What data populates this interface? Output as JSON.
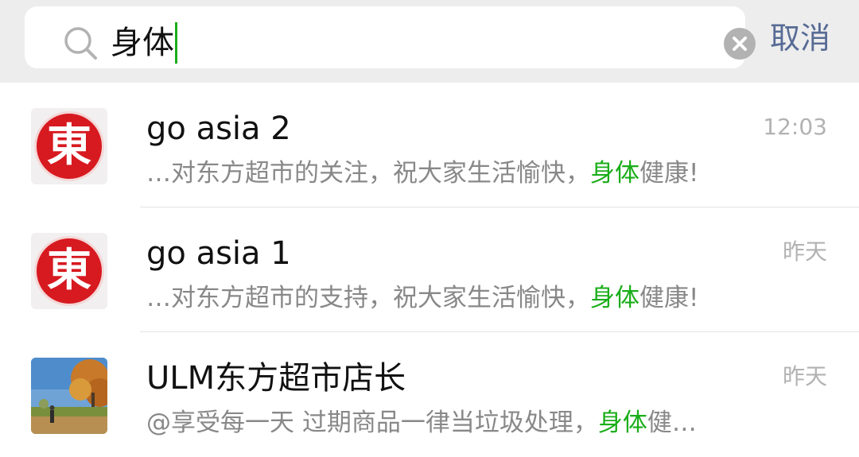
{
  "search": {
    "query": "身体",
    "cancel_label": "取消"
  },
  "results": [
    {
      "name": "go asia 2",
      "time": "12:03",
      "avatar": "dong-logo",
      "avatar_text": "東",
      "snippet_before": "…对东方超市的关注，祝大家生活愉快，",
      "snippet_highlight": "身体",
      "snippet_after": "健康!"
    },
    {
      "name": "go asia 1",
      "time": "昨天",
      "avatar": "dong-logo",
      "avatar_text": "東",
      "snippet_before": "…对东方超市的支持，祝大家生活愉快，",
      "snippet_highlight": "身体",
      "snippet_after": "健康!"
    },
    {
      "name": "ULM东方超市店长",
      "time": "昨天",
      "avatar": "autumn-photo",
      "snippet_before": "@享受每一天 过期商品一律当垃圾处理，",
      "snippet_highlight": "身体",
      "snippet_after": "健…"
    }
  ],
  "colors": {
    "highlight": "#1aad19",
    "cancel": "#576b95",
    "logo_red": "#d71920",
    "caret": "#1aad19"
  }
}
